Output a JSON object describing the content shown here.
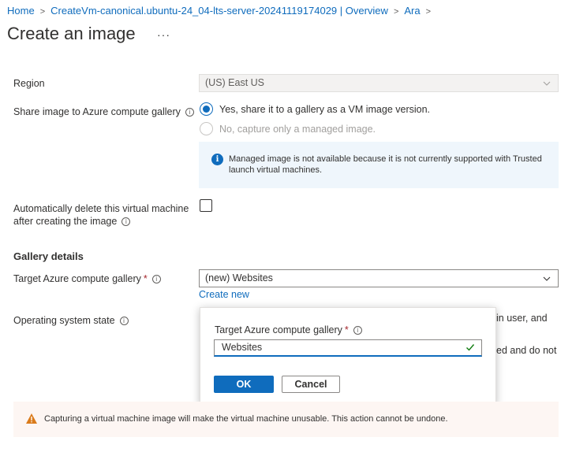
{
  "breadcrumb": {
    "items": [
      "Home",
      "CreateVm-canonical.ubuntu-24_04-lts-server-20241119174029 | Overview",
      "Ara"
    ],
    "separator": ">"
  },
  "header": {
    "title": "Create an image",
    "more": "···"
  },
  "form": {
    "region": {
      "label": "Region",
      "value": "(US) East US"
    },
    "share": {
      "label": "Share image to Azure compute gallery",
      "option_yes": "Yes, share it to a gallery as a VM image version.",
      "option_no": "No, capture only a managed image.",
      "info": "Managed image is not available because it is not currently supported with Trusted launch virtual machines."
    },
    "auto_delete": {
      "label_line1": "Automatically delete this virtual machine",
      "label_line2": "after creating the image",
      "checked": false
    },
    "gallery_section": "Gallery details",
    "target_gallery": {
      "label": "Target Azure compute gallery",
      "required": "*",
      "value": "(new) Websites",
      "create_new": "Create new"
    },
    "os_state": {
      "label": "Operating system state",
      "partial_right_1": "in user, and",
      "partial_right_2": "ed and do not"
    }
  },
  "popup": {
    "label": "Target Azure compute gallery",
    "required": "*",
    "value": "Websites",
    "ok": "OK",
    "cancel": "Cancel"
  },
  "warning": {
    "text": "Capturing a virtual machine image will make the virtual machine unusable. This action cannot be undone."
  },
  "colors": {
    "accent": "#0f6cbd",
    "info_bg": "#eff6fc",
    "warning_bg": "#fdf6f3",
    "warning_icon": "#da7b1b",
    "success": "#107c10"
  }
}
